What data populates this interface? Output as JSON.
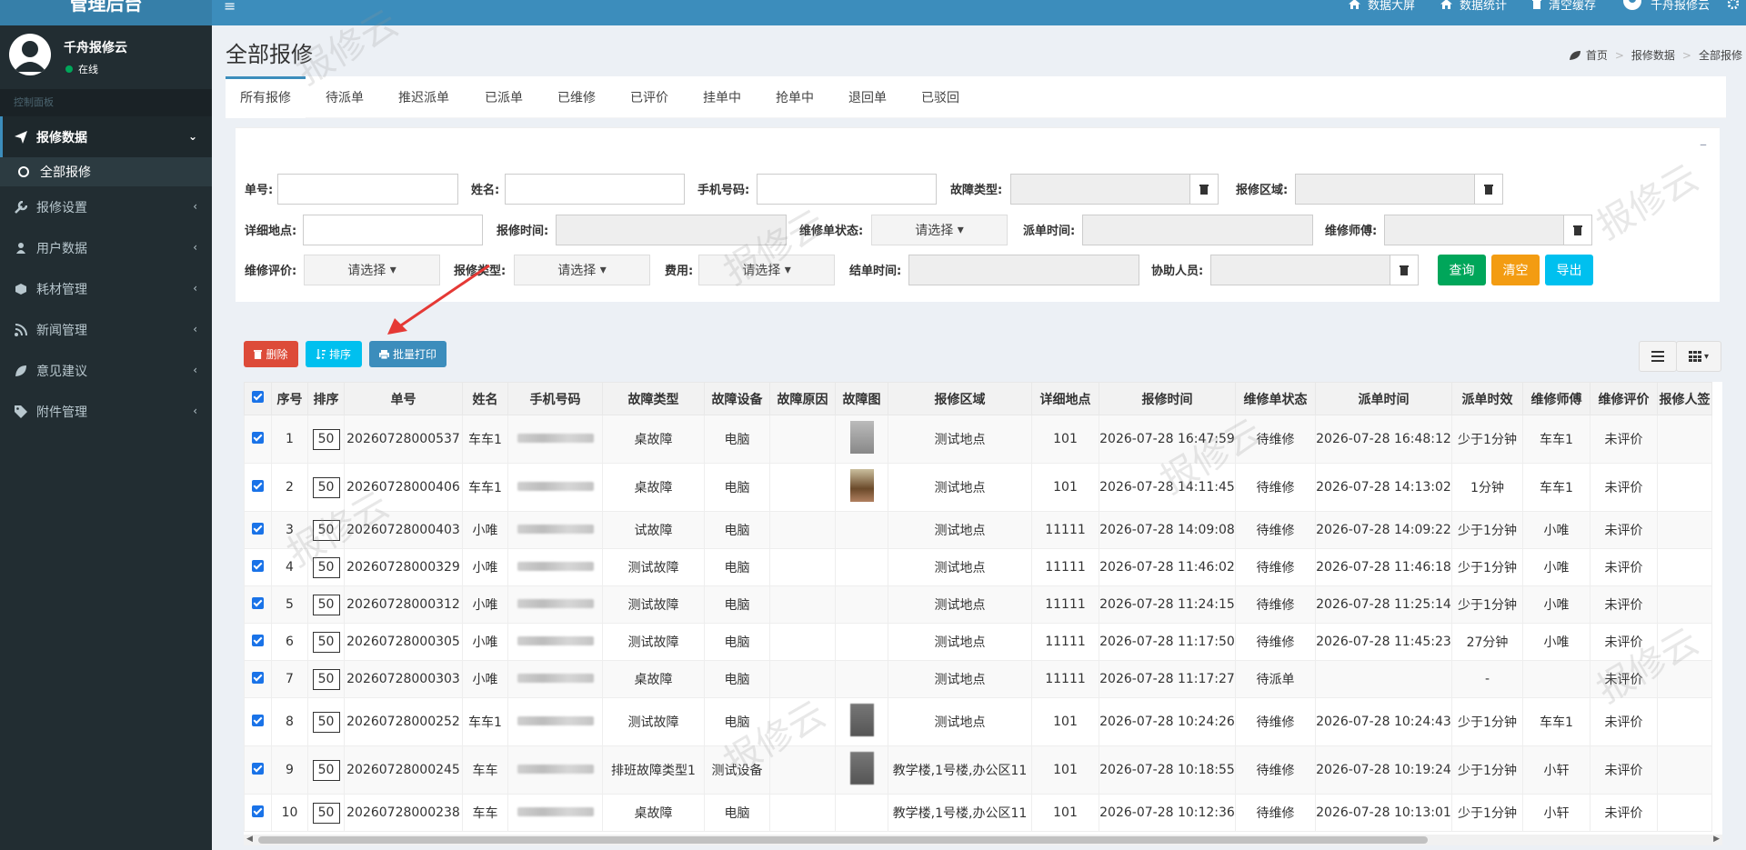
{
  "brand": {
    "title": "管理后台"
  },
  "topnav": {
    "items": [
      "数据大屏",
      "数据统计",
      "清空缓存",
      "千舟报修云"
    ]
  },
  "user": {
    "name": "千舟报修云",
    "status": "在线"
  },
  "sidebar": {
    "header": "控制面板",
    "menu": [
      {
        "label": "报修数据",
        "icon": "paper-plane-icon"
      },
      {
        "label": "全部报修"
      },
      {
        "label": "报修设置",
        "icon": "wrench-icon"
      },
      {
        "label": "用户数据",
        "icon": "user-icon"
      },
      {
        "label": "耗材管理",
        "icon": "cube-icon"
      },
      {
        "label": "新闻管理",
        "icon": "rss-icon"
      },
      {
        "label": "意见建议",
        "icon": "leaf-icon"
      },
      {
        "label": "附件管理",
        "icon": "tag-icon"
      }
    ]
  },
  "page": {
    "title": "全部报修",
    "breadcrumb": [
      "首页",
      "报修数据",
      "全部报修"
    ]
  },
  "tabs": [
    "所有报修",
    "待派单",
    "推迟派单",
    "已派单",
    "已维修",
    "已评价",
    "挂单中",
    "抢单中",
    "退回单",
    "已驳回"
  ],
  "filters": {
    "labels": {
      "order_no": "单号:",
      "name": "姓名:",
      "phone": "手机号码:",
      "fault_type": "故障类型:",
      "area": "报修区域:",
      "address": "详细地点:",
      "time": "报修时间:",
      "status": "维修单状态:",
      "dispatch_time": "派单时间:",
      "worker": "维修师傅:",
      "rating": "维修评价:",
      "repair_type": "报修类型:",
      "fee": "费用:",
      "finish_time": "结单时间:",
      "assistant": "协助人员:"
    },
    "select_placeholder": "请选择",
    "buttons": {
      "query": "查询",
      "clear": "清空",
      "export": "导出"
    }
  },
  "toolbar": {
    "delete": "删除",
    "sort": "排序",
    "batch_print": "批量打印"
  },
  "table": {
    "headers": [
      "",
      "序号",
      "排序",
      "单号",
      "姓名",
      "手机号码",
      "故障类型",
      "故障设备",
      "故障原因",
      "故障图",
      "报修区域",
      "详细地点",
      "报修时间",
      "维修单状态",
      "派单时间",
      "派单时效",
      "维修师傅",
      "维修评价",
      "报修人签"
    ],
    "rows": [
      {
        "idx": "1",
        "sort": "50",
        "no": "20260728000537",
        "name": "车车1",
        "type": "桌故障",
        "device": "电脑",
        "thumb": "gray",
        "area": "测试地点",
        "addr": "101",
        "time": "2026-07-28 16:47:59",
        "status": "待维修",
        "dtime": "2026-07-28 16:48:12",
        "eff": "少于1分钟",
        "worker": "车车1",
        "rate": "未评价"
      },
      {
        "idx": "2",
        "sort": "50",
        "no": "20260728000406",
        "name": "车车1",
        "type": "桌故障",
        "device": "电脑",
        "thumb": "brown",
        "area": "测试地点",
        "addr": "101",
        "time": "2026-07-28 14:11:45",
        "status": "待维修",
        "dtime": "2026-07-28 14:13:02",
        "eff": "1分钟",
        "worker": "车车1",
        "rate": "未评价"
      },
      {
        "idx": "3",
        "sort": "50",
        "no": "20260728000403",
        "name": "小唯",
        "type": "试故障",
        "device": "电脑",
        "thumb": "",
        "area": "测试地点",
        "addr": "11111",
        "time": "2026-07-28 14:09:08",
        "status": "待维修",
        "dtime": "2026-07-28 14:09:22",
        "eff": "少于1分钟",
        "worker": "小唯",
        "rate": "未评价"
      },
      {
        "idx": "4",
        "sort": "50",
        "no": "20260728000329",
        "name": "小唯",
        "type": "测试故障",
        "device": "电脑",
        "thumb": "",
        "area": "测试地点",
        "addr": "11111",
        "time": "2026-07-28 11:46:02",
        "status": "待维修",
        "dtime": "2026-07-28 11:46:18",
        "eff": "少于1分钟",
        "worker": "小唯",
        "rate": "未评价"
      },
      {
        "idx": "5",
        "sort": "50",
        "no": "20260728000312",
        "name": "小唯",
        "type": "测试故障",
        "device": "电脑",
        "thumb": "",
        "area": "测试地点",
        "addr": "11111",
        "time": "2026-07-28 11:24:15",
        "status": "待维修",
        "dtime": "2026-07-28 11:25:14",
        "eff": "少于1分钟",
        "worker": "小唯",
        "rate": "未评价"
      },
      {
        "idx": "6",
        "sort": "50",
        "no": "20260728000305",
        "name": "小唯",
        "type": "测试故障",
        "device": "电脑",
        "thumb": "",
        "area": "测试地点",
        "addr": "11111",
        "time": "2026-07-28 11:17:50",
        "status": "待维修",
        "dtime": "2026-07-28 11:45:23",
        "eff": "27分钟",
        "worker": "小唯",
        "rate": "未评价"
      },
      {
        "idx": "7",
        "sort": "50",
        "no": "20260728000303",
        "name": "小唯",
        "type": "桌故障",
        "device": "电脑",
        "thumb": "",
        "area": "测试地点",
        "addr": "11111",
        "time": "2026-07-28 11:17:27",
        "status": "待派单",
        "dtime": "",
        "eff": "-",
        "worker": "",
        "rate": "未评价"
      },
      {
        "idx": "8",
        "sort": "50",
        "no": "20260728000252",
        "name": "车车1",
        "type": "测试故障",
        "device": "电脑",
        "thumb": "dark",
        "area": "测试地点",
        "addr": "101",
        "time": "2026-07-28 10:24:26",
        "status": "待维修",
        "dtime": "2026-07-28 10:24:43",
        "eff": "少于1分钟",
        "worker": "车车1",
        "rate": "未评价"
      },
      {
        "idx": "9",
        "sort": "50",
        "no": "20260728000245",
        "name": "车车",
        "type": "排班故障类型1",
        "device": "测试设备",
        "thumb": "dark",
        "area": "教学楼,1号楼,办公区11",
        "addr": "101",
        "time": "2026-07-28 10:18:55",
        "status": "待维修",
        "dtime": "2026-07-28 10:19:24",
        "eff": "少于1分钟",
        "worker": "小轩",
        "rate": "未评价"
      },
      {
        "idx": "10",
        "sort": "50",
        "no": "20260728000238",
        "name": "车车",
        "type": "桌故障",
        "device": "电脑",
        "thumb": "",
        "area": "教学楼,1号楼,办公区11",
        "addr": "101",
        "time": "2026-07-28 10:12:36",
        "status": "待维修",
        "dtime": "2026-07-28 10:13:01",
        "eff": "少于1分钟",
        "worker": "小轩",
        "rate": "未评价"
      }
    ]
  },
  "watermark": "报修云",
  "colors": {
    "primary": "#3c8dbc",
    "success": "#00a65a",
    "warning": "#f39c12",
    "info": "#00c0ef",
    "danger": "#dd4b39"
  }
}
